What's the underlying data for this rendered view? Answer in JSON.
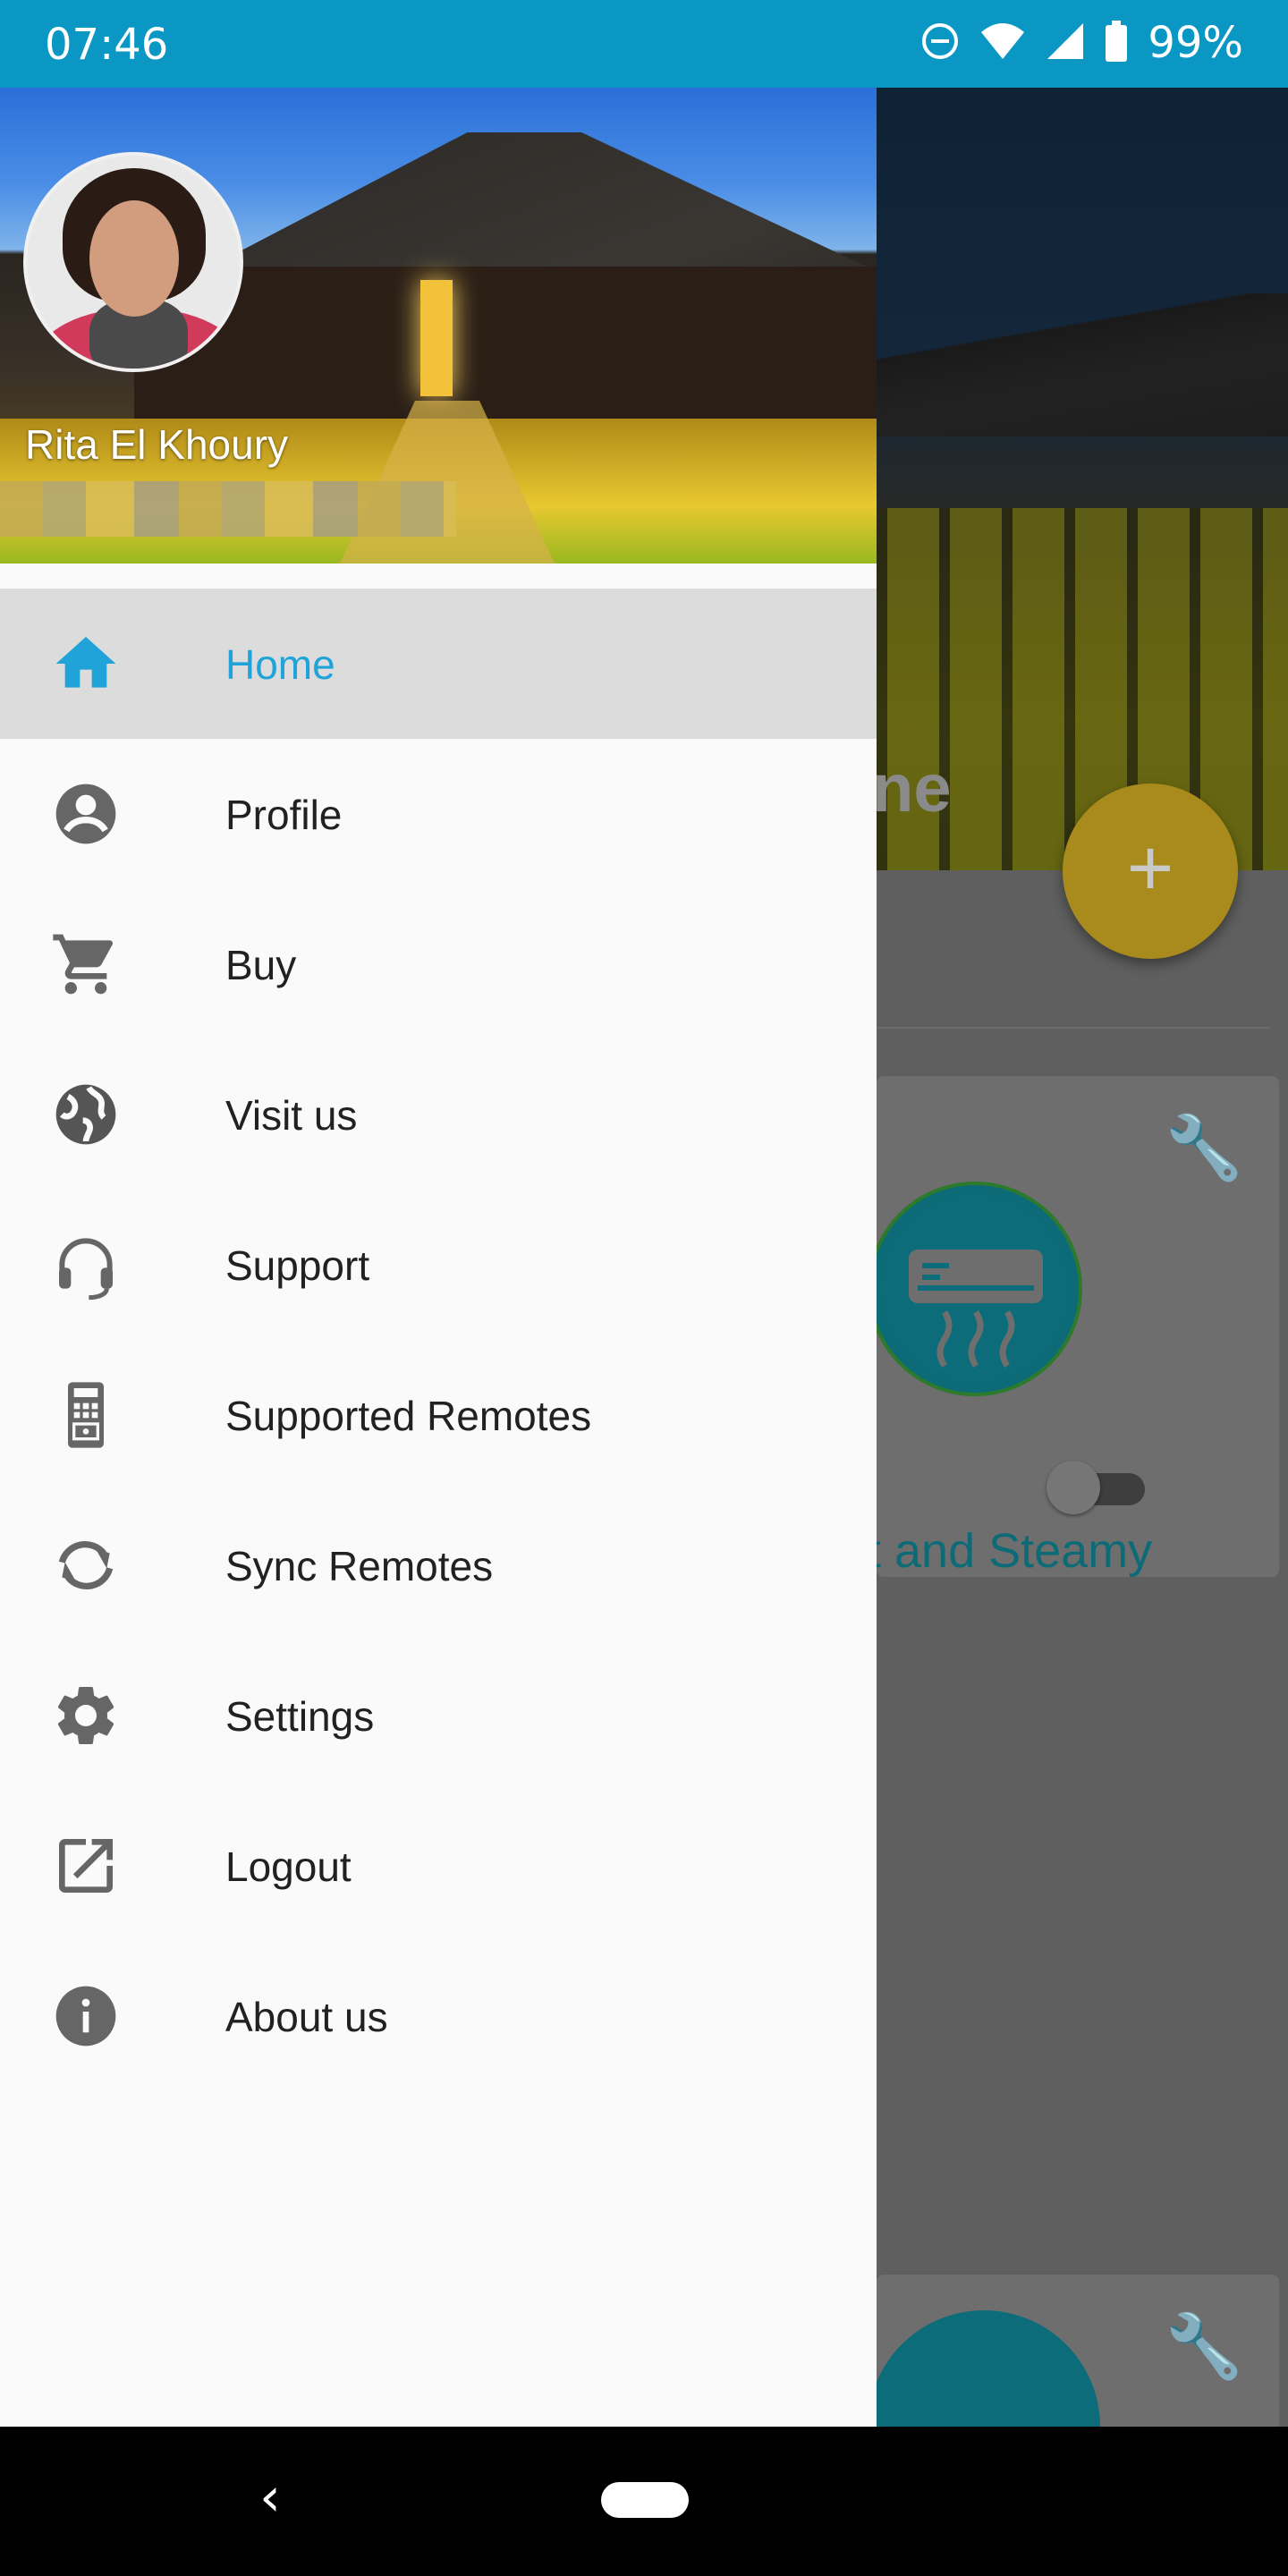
{
  "status_bar": {
    "time": "07:46",
    "battery_percent": "99%",
    "icons": [
      "do-not-disturb-icon",
      "wifi-icon",
      "cell-signal-icon",
      "battery-icon"
    ],
    "color": "#0a97c3"
  },
  "drawer": {
    "user": {
      "name": "Rita El Khoury"
    },
    "accent_color": "#1fa3d8",
    "items": [
      {
        "label": "Home",
        "icon": "home-icon",
        "active": true
      },
      {
        "label": "Profile",
        "icon": "account-circle-icon",
        "active": false
      },
      {
        "label": "Buy",
        "icon": "cart-icon",
        "active": false
      },
      {
        "label": "Visit us",
        "icon": "globe-icon",
        "active": false
      },
      {
        "label": "Support",
        "icon": "headset-icon",
        "active": false
      },
      {
        "label": "Supported Remotes",
        "icon": "remote-control-icon",
        "active": false
      },
      {
        "label": "Sync Remotes",
        "icon": "sync-icon",
        "active": false
      },
      {
        "label": "Settings",
        "icon": "gear-icon",
        "active": false
      },
      {
        "label": "Logout",
        "icon": "exit-icon",
        "active": false
      },
      {
        "label": "About us",
        "icon": "info-icon",
        "active": false
      }
    ]
  },
  "background_app": {
    "hero_partial_text": "ne",
    "fab_label": "+",
    "card1_partial_label": "t and Steamy"
  },
  "nav_bar": {
    "back_label": "‹"
  }
}
